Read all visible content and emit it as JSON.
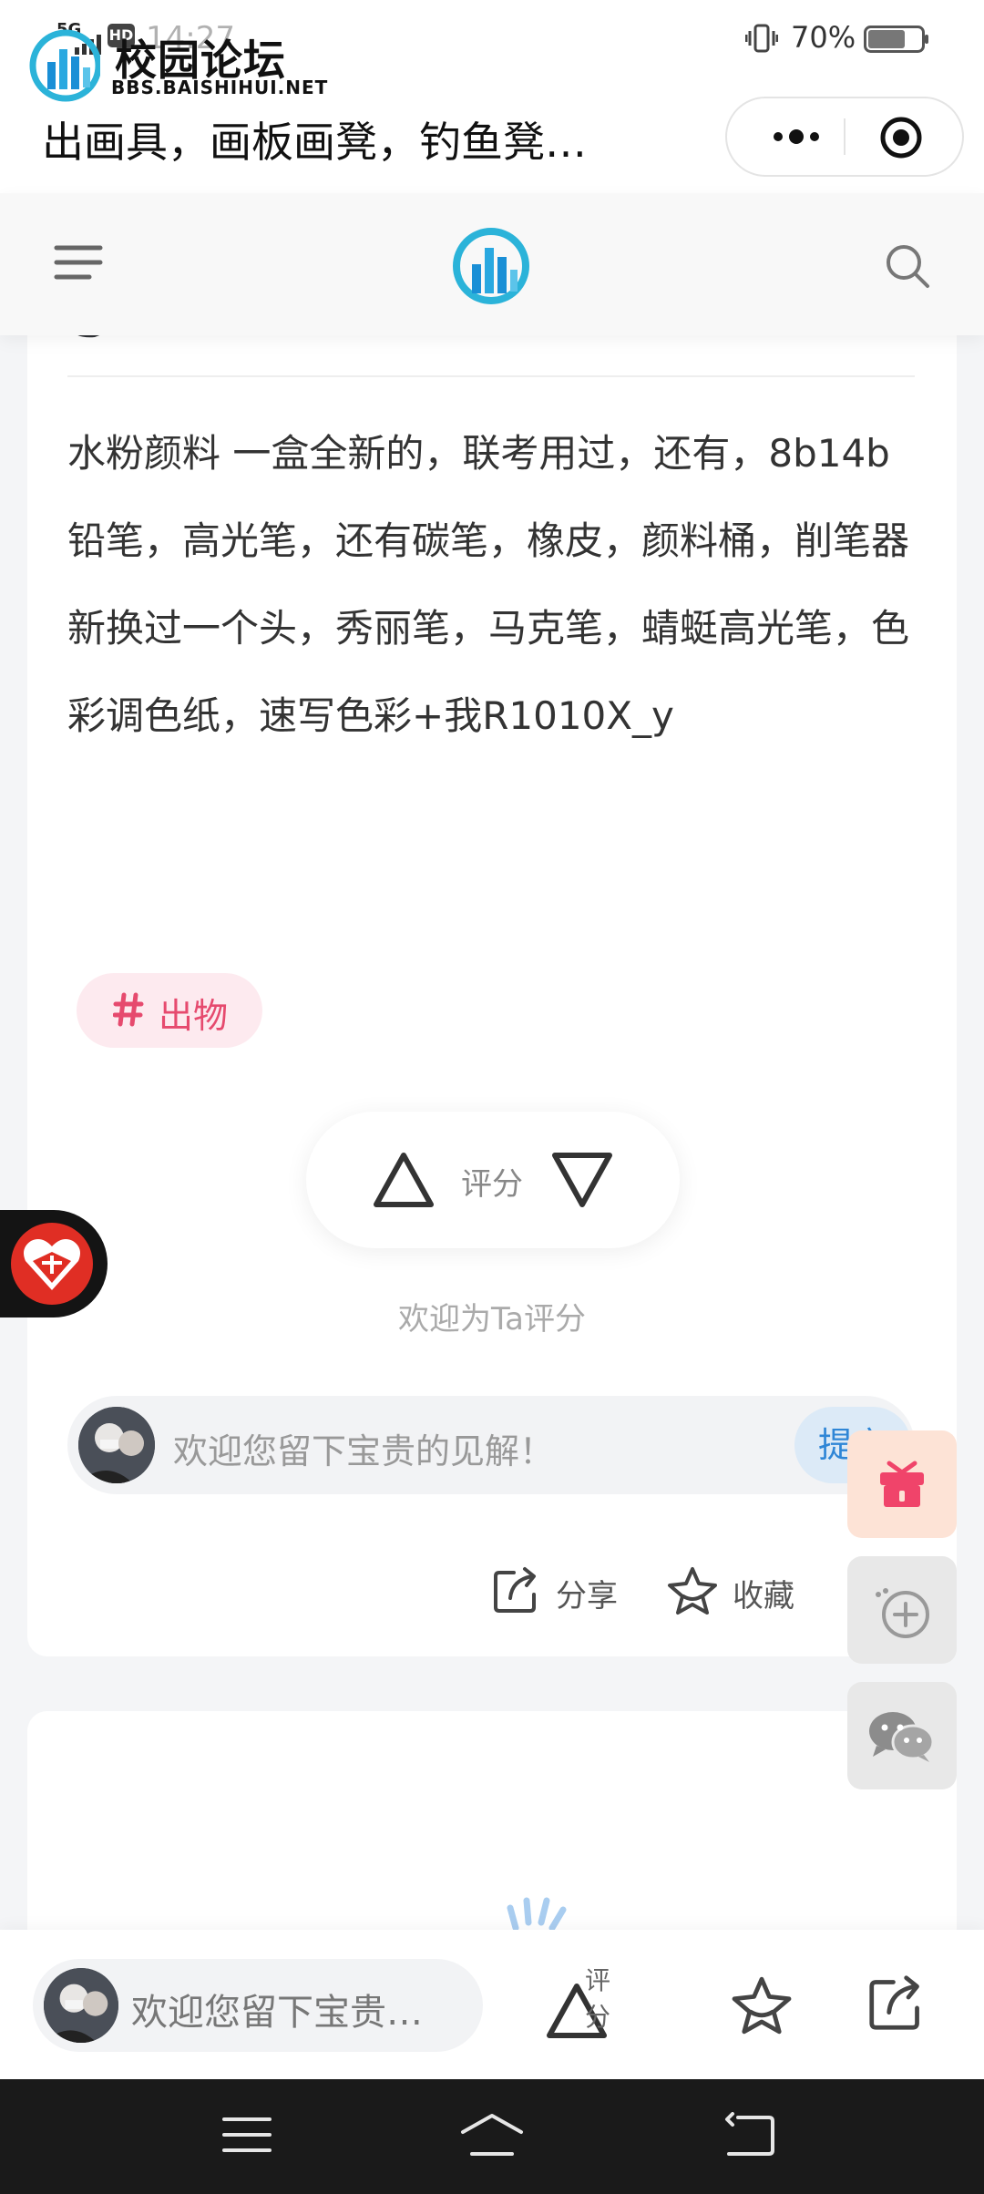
{
  "status_bar": {
    "network": "5G",
    "time": "14:27",
    "hd": "HD",
    "battery": "70%",
    "battery_level": 0.7
  },
  "app": {
    "logo_title": "校园论坛",
    "logo_url": "BBS.BAISHIHUI.NET",
    "page_title": "出画具，画板画凳，钓鱼凳…"
  },
  "post": {
    "body": "水粉颜料 一盒全新的，联考用过，还有，8b14b铅笔，高光笔，还有碳笔，橡皮，颜料桶，削笔器新换过一个头，秀丽笔，马克笔，蜻蜓高光笔，色彩调色纸，速写色彩+我R1010X_y",
    "tag": "出物",
    "rate_label": "评分",
    "rate_hint": "欢迎为Ta评分",
    "comment_placeholder": "欢迎您留下宝贵的见解！",
    "submit_label": "提交",
    "share_label": "分享",
    "favorite_label": "收藏"
  },
  "bottom_bar": {
    "input_placeholder": "欢迎您留下宝贵…",
    "rate_label": "评分"
  },
  "colors": {
    "accent": "#2f86d6",
    "tag": "#e64a6e",
    "tag_bg": "#fdeaef",
    "gift": "#f0446a"
  },
  "icons": [
    "menu-icon",
    "search-icon",
    "more-icon",
    "close-target-icon",
    "hash-icon",
    "thumb-up-triangle-icon",
    "thumb-down-triangle-icon",
    "share-icon",
    "star-icon",
    "gift-icon",
    "add-circle-icon",
    "wechat-icon",
    "pinduoduo-icon",
    "nav-menu-icon",
    "nav-home-icon",
    "nav-back-icon"
  ]
}
